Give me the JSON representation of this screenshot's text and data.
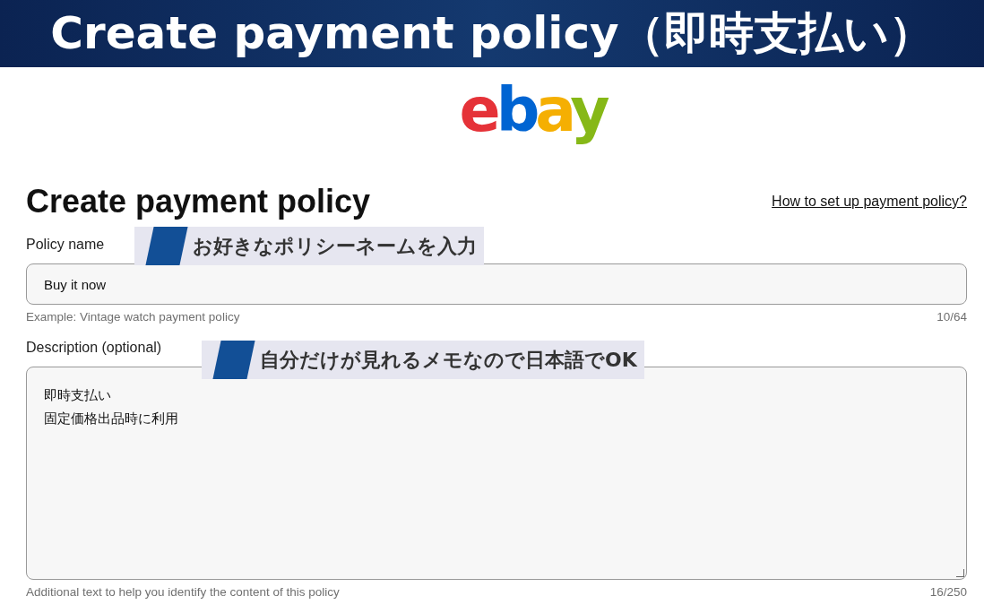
{
  "banner": {
    "title": "Create payment policy（即時支払い）"
  },
  "logo": {
    "text": "ebay"
  },
  "form": {
    "heading": "Create payment policy",
    "help_link": "How to set up payment policy?",
    "fields": [
      {
        "kind": "input",
        "label": "Policy name",
        "value": "Buy it now",
        "hint": "Example: Vintage watch payment policy",
        "count": "10/64"
      },
      {
        "kind": "textarea",
        "label": "Description (optional)",
        "lines": [
          "即時支払い",
          "固定価格出品時に利用"
        ],
        "hint": "Additional text to help you identify the content of this policy",
        "count": "16/250"
      }
    ]
  },
  "callouts": [
    {
      "text": "お好きなポリシーネームを入力"
    },
    {
      "text": "自分だけが見れるメモなので日本語でOK"
    }
  ]
}
